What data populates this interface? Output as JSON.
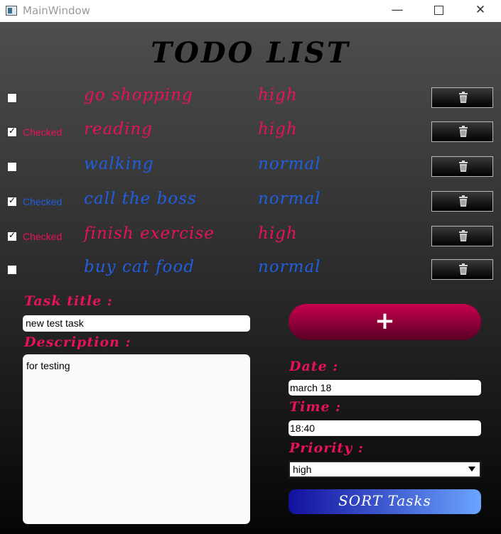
{
  "window": {
    "title": "MainWindow",
    "minimize": "—",
    "close": "✕"
  },
  "heading": "TODO LIST",
  "tasks": [
    {
      "title": "go shopping",
      "priority": "high",
      "checked": false,
      "check_label": "",
      "color": "#e8125a"
    },
    {
      "title": "reading",
      "priority": "high",
      "checked": true,
      "check_label": "Checked",
      "color": "#e8125a"
    },
    {
      "title": "walking",
      "priority": "normal",
      "checked": false,
      "check_label": "",
      "color": "#1f5fe0"
    },
    {
      "title": "call the boss",
      "priority": "normal",
      "checked": true,
      "check_label": "Checked",
      "color": "#1f5fe0"
    },
    {
      "title": "finish exercise",
      "priority": "high",
      "checked": true,
      "check_label": "Checked",
      "color": "#e8125a"
    },
    {
      "title": "buy cat food",
      "priority": "normal",
      "checked": false,
      "check_label": "",
      "color": "#1f5fe0"
    }
  ],
  "form": {
    "task_title_label": "Task title :",
    "task_title_value": "new test task",
    "description_label": "Description :",
    "description_value": "for testing",
    "add_label": "+",
    "date_label": "Date :",
    "date_value": "march 18",
    "time_label": "Time :",
    "time_value": "18:40",
    "priority_label": "Priority :",
    "priority_value": "high",
    "sort_label": "SORT Tasks"
  },
  "colors": {
    "high": "#e8125a",
    "normal": "#1f5fe0"
  },
  "icons": {
    "delete": "trash-icon"
  }
}
